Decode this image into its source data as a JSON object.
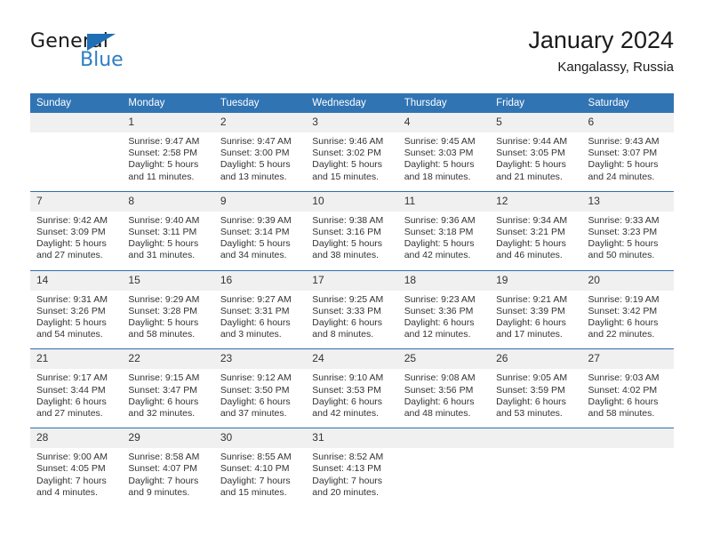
{
  "brand": {
    "name_dark": "General",
    "name_blue": "Blue",
    "triangle_color": "#1f6fb6",
    "blue_color": "#2f7fc4"
  },
  "header": {
    "title": "January 2024",
    "subtitle": "Kangalassy, Russia"
  },
  "theme": {
    "header_blue": "#3074b4",
    "rule_blue": "#2f6fad",
    "daynum_band": "#f0f0f0",
    "text": "#333333"
  },
  "calendar": {
    "weekdays": [
      "Sunday",
      "Monday",
      "Tuesday",
      "Wednesday",
      "Thursday",
      "Friday",
      "Saturday"
    ],
    "weeks": [
      [
        {
          "day": "",
          "lines": [
            "",
            "",
            "",
            ""
          ]
        },
        {
          "day": "1",
          "lines": [
            "Sunrise: 9:47 AM",
            "Sunset: 2:58 PM",
            "Daylight: 5 hours",
            "and 11 minutes."
          ]
        },
        {
          "day": "2",
          "lines": [
            "Sunrise: 9:47 AM",
            "Sunset: 3:00 PM",
            "Daylight: 5 hours",
            "and 13 minutes."
          ]
        },
        {
          "day": "3",
          "lines": [
            "Sunrise: 9:46 AM",
            "Sunset: 3:02 PM",
            "Daylight: 5 hours",
            "and 15 minutes."
          ]
        },
        {
          "day": "4",
          "lines": [
            "Sunrise: 9:45 AM",
            "Sunset: 3:03 PM",
            "Daylight: 5 hours",
            "and 18 minutes."
          ]
        },
        {
          "day": "5",
          "lines": [
            "Sunrise: 9:44 AM",
            "Sunset: 3:05 PM",
            "Daylight: 5 hours",
            "and 21 minutes."
          ]
        },
        {
          "day": "6",
          "lines": [
            "Sunrise: 9:43 AM",
            "Sunset: 3:07 PM",
            "Daylight: 5 hours",
            "and 24 minutes."
          ]
        }
      ],
      [
        {
          "day": "7",
          "lines": [
            "Sunrise: 9:42 AM",
            "Sunset: 3:09 PM",
            "Daylight: 5 hours",
            "and 27 minutes."
          ]
        },
        {
          "day": "8",
          "lines": [
            "Sunrise: 9:40 AM",
            "Sunset: 3:11 PM",
            "Daylight: 5 hours",
            "and 31 minutes."
          ]
        },
        {
          "day": "9",
          "lines": [
            "Sunrise: 9:39 AM",
            "Sunset: 3:14 PM",
            "Daylight: 5 hours",
            "and 34 minutes."
          ]
        },
        {
          "day": "10",
          "lines": [
            "Sunrise: 9:38 AM",
            "Sunset: 3:16 PM",
            "Daylight: 5 hours",
            "and 38 minutes."
          ]
        },
        {
          "day": "11",
          "lines": [
            "Sunrise: 9:36 AM",
            "Sunset: 3:18 PM",
            "Daylight: 5 hours",
            "and 42 minutes."
          ]
        },
        {
          "day": "12",
          "lines": [
            "Sunrise: 9:34 AM",
            "Sunset: 3:21 PM",
            "Daylight: 5 hours",
            "and 46 minutes."
          ]
        },
        {
          "day": "13",
          "lines": [
            "Sunrise: 9:33 AM",
            "Sunset: 3:23 PM",
            "Daylight: 5 hours",
            "and 50 minutes."
          ]
        }
      ],
      [
        {
          "day": "14",
          "lines": [
            "Sunrise: 9:31 AM",
            "Sunset: 3:26 PM",
            "Daylight: 5 hours",
            "and 54 minutes."
          ]
        },
        {
          "day": "15",
          "lines": [
            "Sunrise: 9:29 AM",
            "Sunset: 3:28 PM",
            "Daylight: 5 hours",
            "and 58 minutes."
          ]
        },
        {
          "day": "16",
          "lines": [
            "Sunrise: 9:27 AM",
            "Sunset: 3:31 PM",
            "Daylight: 6 hours",
            "and 3 minutes."
          ]
        },
        {
          "day": "17",
          "lines": [
            "Sunrise: 9:25 AM",
            "Sunset: 3:33 PM",
            "Daylight: 6 hours",
            "and 8 minutes."
          ]
        },
        {
          "day": "18",
          "lines": [
            "Sunrise: 9:23 AM",
            "Sunset: 3:36 PM",
            "Daylight: 6 hours",
            "and 12 minutes."
          ]
        },
        {
          "day": "19",
          "lines": [
            "Sunrise: 9:21 AM",
            "Sunset: 3:39 PM",
            "Daylight: 6 hours",
            "and 17 minutes."
          ]
        },
        {
          "day": "20",
          "lines": [
            "Sunrise: 9:19 AM",
            "Sunset: 3:42 PM",
            "Daylight: 6 hours",
            "and 22 minutes."
          ]
        }
      ],
      [
        {
          "day": "21",
          "lines": [
            "Sunrise: 9:17 AM",
            "Sunset: 3:44 PM",
            "Daylight: 6 hours",
            "and 27 minutes."
          ]
        },
        {
          "day": "22",
          "lines": [
            "Sunrise: 9:15 AM",
            "Sunset: 3:47 PM",
            "Daylight: 6 hours",
            "and 32 minutes."
          ]
        },
        {
          "day": "23",
          "lines": [
            "Sunrise: 9:12 AM",
            "Sunset: 3:50 PM",
            "Daylight: 6 hours",
            "and 37 minutes."
          ]
        },
        {
          "day": "24",
          "lines": [
            "Sunrise: 9:10 AM",
            "Sunset: 3:53 PM",
            "Daylight: 6 hours",
            "and 42 minutes."
          ]
        },
        {
          "day": "25",
          "lines": [
            "Sunrise: 9:08 AM",
            "Sunset: 3:56 PM",
            "Daylight: 6 hours",
            "and 48 minutes."
          ]
        },
        {
          "day": "26",
          "lines": [
            "Sunrise: 9:05 AM",
            "Sunset: 3:59 PM",
            "Daylight: 6 hours",
            "and 53 minutes."
          ]
        },
        {
          "day": "27",
          "lines": [
            "Sunrise: 9:03 AM",
            "Sunset: 4:02 PM",
            "Daylight: 6 hours",
            "and 58 minutes."
          ]
        }
      ],
      [
        {
          "day": "28",
          "lines": [
            "Sunrise: 9:00 AM",
            "Sunset: 4:05 PM",
            "Daylight: 7 hours",
            "and 4 minutes."
          ]
        },
        {
          "day": "29",
          "lines": [
            "Sunrise: 8:58 AM",
            "Sunset: 4:07 PM",
            "Daylight: 7 hours",
            "and 9 minutes."
          ]
        },
        {
          "day": "30",
          "lines": [
            "Sunrise: 8:55 AM",
            "Sunset: 4:10 PM",
            "Daylight: 7 hours",
            "and 15 minutes."
          ]
        },
        {
          "day": "31",
          "lines": [
            "Sunrise: 8:52 AM",
            "Sunset: 4:13 PM",
            "Daylight: 7 hours",
            "and 20 minutes."
          ]
        },
        {
          "day": "",
          "lines": [
            "",
            "",
            "",
            ""
          ]
        },
        {
          "day": "",
          "lines": [
            "",
            "",
            "",
            ""
          ]
        },
        {
          "day": "",
          "lines": [
            "",
            "",
            "",
            ""
          ]
        }
      ]
    ]
  }
}
